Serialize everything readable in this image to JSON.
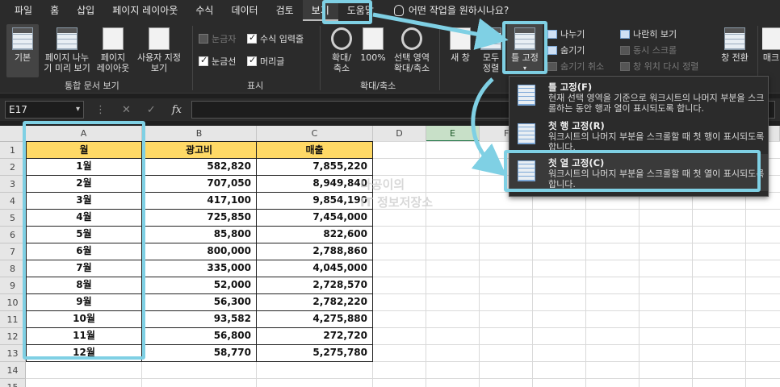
{
  "menu": {
    "items": [
      "파일",
      "홈",
      "삽입",
      "페이지 레이아웃",
      "수식",
      "데이터",
      "검토",
      "보기",
      "도움말"
    ],
    "tell_me": "어떤 작업을 원하시나요?"
  },
  "ribbon": {
    "workbook_views": {
      "normal": "기본",
      "page_break_1": "페이지 나누",
      "page_break_2": "기 미리 보기",
      "page_layout_1": "페이지",
      "page_layout_2": "레이아웃",
      "custom_1": "사용자 지정",
      "custom_2": "보기",
      "label": "통합 문서 보기"
    },
    "show": {
      "ruler": "눈금자",
      "formula_bar": "수식 입력줄",
      "gridlines": "눈금선",
      "headings": "머리글",
      "label": "표시"
    },
    "zoom": {
      "zoom_1": "확대/",
      "zoom_2": "축소",
      "hundred": "100%",
      "selection_1": "선택 영역",
      "selection_2": "확대/축소",
      "label": "확대/축소"
    },
    "window": {
      "new_window": "새 창",
      "arrange_1": "모두",
      "arrange_2": "정렬",
      "freeze": "틀 고정",
      "split": "나누기",
      "hide": "숨기기",
      "unhide": "숨기기 취소",
      "side_by_side": "나란히 보기",
      "sync_scroll": "동시 스크롤",
      "reset_pos": "창 위치 다시 정렬",
      "switch": "창 전환",
      "macro": "매크"
    }
  },
  "formula_bar": {
    "name_box": "E17",
    "fx": "fx"
  },
  "sheet": {
    "columns": [
      "A",
      "B",
      "C",
      "D",
      "E",
      "F"
    ],
    "rows": [
      "1",
      "2",
      "3",
      "4",
      "5",
      "6",
      "7",
      "8",
      "9",
      "10",
      "11",
      "12",
      "13",
      "14",
      "15"
    ],
    "header": [
      "월",
      "광고비",
      "매출"
    ],
    "data": [
      [
        "1월",
        "582,820",
        "7,855,220"
      ],
      [
        "2월",
        "707,050",
        "8,949,840"
      ],
      [
        "3월",
        "417,100",
        "9,854,190"
      ],
      [
        "4월",
        "725,850",
        "7,454,000"
      ],
      [
        "5월",
        "85,800",
        "822,600"
      ],
      [
        "6월",
        "800,000",
        "2,788,860"
      ],
      [
        "7월",
        "335,000",
        "4,045,000"
      ],
      [
        "8월",
        "52,000",
        "2,728,570"
      ],
      [
        "9월",
        "56,300",
        "2,782,220"
      ],
      [
        "10월",
        "93,582",
        "4,275,880"
      ],
      [
        "11월",
        "56,800",
        "272,720"
      ],
      [
        "12월",
        "58,770",
        "5,275,780"
      ]
    ],
    "watermark_1": "나공이의",
    "watermark_2": "IT 정보저장소"
  },
  "dropdown": {
    "items": [
      {
        "title": "틀 고정(F)",
        "desc": "현재 선택 영역을 기준으로 워크시트의 나머지 부분을 스크롤하는 동안 행과 열이 표시되도록 합니다."
      },
      {
        "title": "첫 행 고정(R)",
        "desc": "워크시트의 나머지 부분을 스크롤할 때 첫 행이 표시되도록 합니다."
      },
      {
        "title": "첫 열 고정(C)",
        "desc": "워크시트의 나머지 부분을 스크롤할 때 첫 열이 표시되도록 합니다."
      }
    ]
  },
  "colors": {
    "highlight": "#7fd0e4",
    "header_fill": "#ffd966",
    "ribbon_bg": "#2b2b2b"
  }
}
